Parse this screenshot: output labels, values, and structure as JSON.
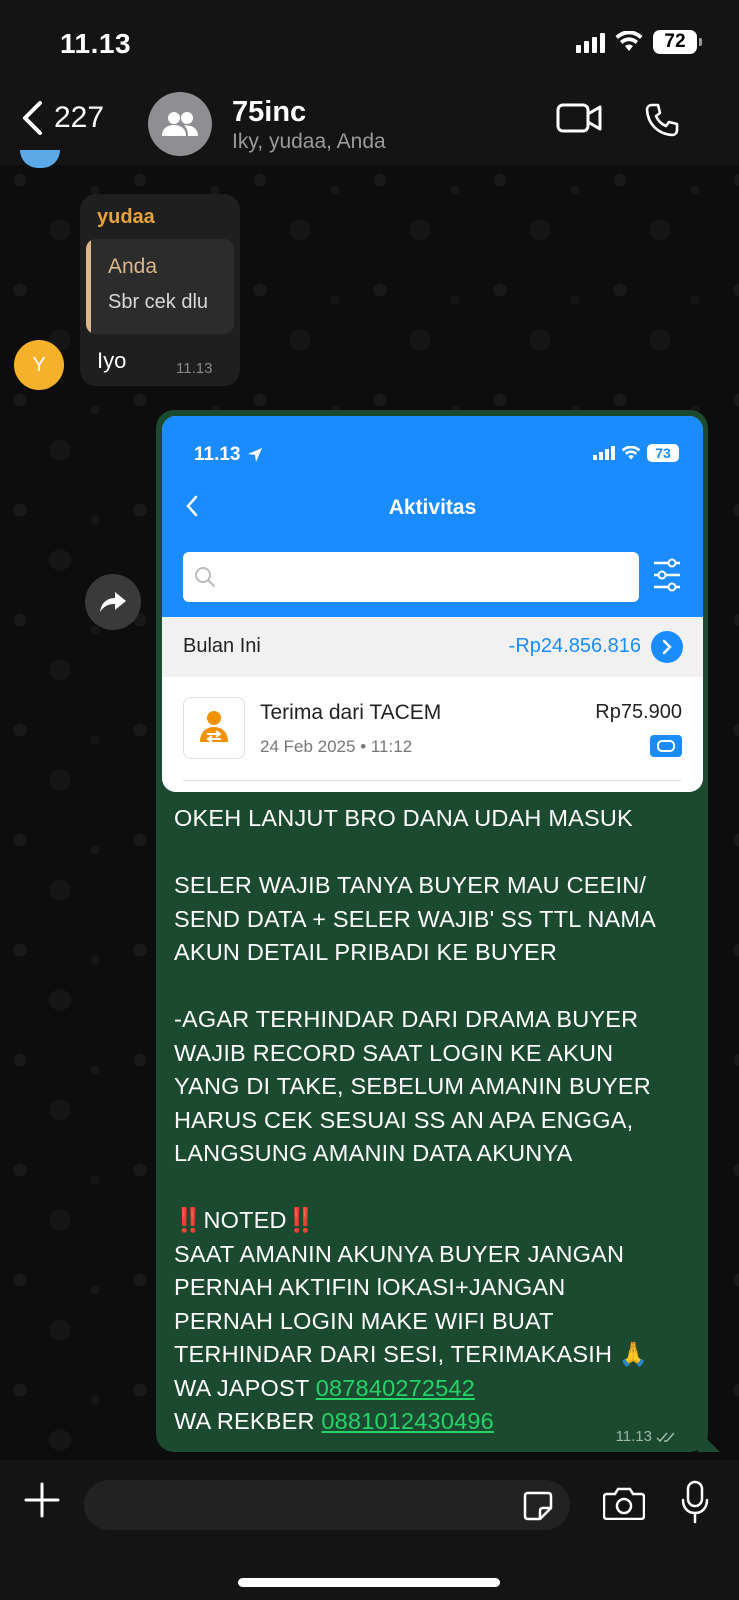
{
  "status_bar": {
    "time": "11.13",
    "battery": "72"
  },
  "header": {
    "back_count": "227",
    "chat_name": "75inc",
    "members": "Iky, yudaa, Anda"
  },
  "incoming": {
    "sender": "yudaa",
    "avatar_initial": "Y",
    "quoted_name": "Anda",
    "quoted_text": "Sbr cek dlu",
    "text": "Iyo",
    "time": "11.13"
  },
  "outgoing": {
    "time": "11.13",
    "screenshot": {
      "time": "11.13",
      "battery": "73",
      "title": "Aktivitas",
      "month_label": "Bulan Ini",
      "month_total": "-Rp24.856.816",
      "txn_title": "Terima dari TACEM",
      "txn_date": "24 Feb 2025 • 11:12",
      "txn_amount": "Rp75.900"
    },
    "lines": [
      "OKEH LANJUT BRO DANA UDAH MASUK",
      "",
      "SELER WAJIB TANYA BUYER MAU CEEIN/",
      "SEND DATA + SELER WAJIB' SS TTL NAMA",
      "AKUN DETAIL PRIBADI KE BUYER",
      "",
      "-AGAR TERHINDAR DARI DRAMA BUYER",
      "WAJIB RECORD SAAT LOGIN KE AKUN",
      "YANG DI TAKE, SEBELUM AMANIN BUYER",
      "HARUS CEK SESUAI SS AN APA ENGGA,",
      "LANGSUNG AMANIN DATA AKUNYA",
      "",
      "‼️NOTED‼️",
      "SAAT AMANIN AKUNYA BUYER JANGAN",
      "PERNAH AKTIFIN lOKASI+JANGAN",
      "PERNAH LOGIN MAKE WIFI BUAT",
      "TERHINDAR DARI SESI, TERIMAKASIH 🙏"
    ],
    "wa_japost_label": "WA JAPOST ",
    "wa_japost_number": "087840272542",
    "wa_rekber_label": "WA REKBER ",
    "wa_rekber_number": "0881012430496"
  }
}
